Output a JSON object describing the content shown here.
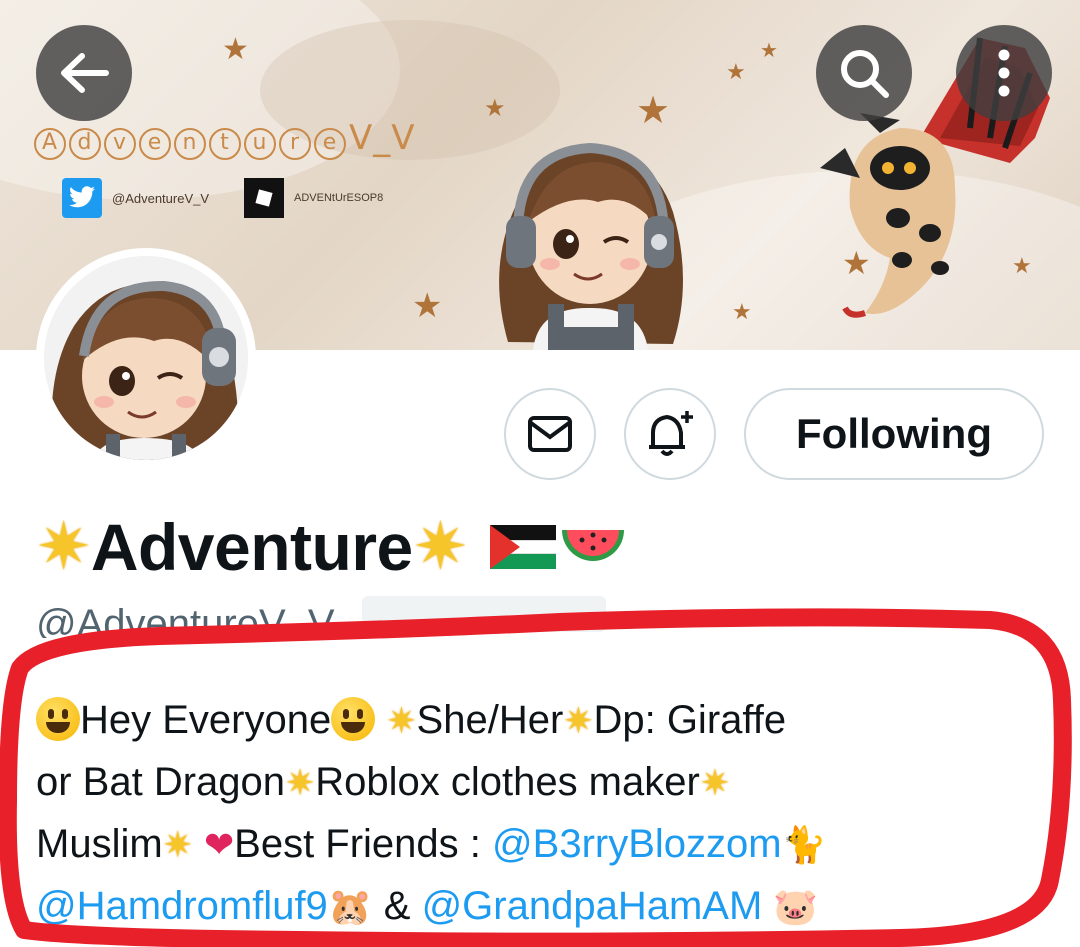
{
  "banner": {
    "handle_title": "AdventureV_V",
    "twitter_handle": "@AdventureV_V",
    "roblox_handle": "ADVENtUrESOP8"
  },
  "nav": {
    "back_icon": "arrow-left-icon",
    "search_icon": "search-icon",
    "more_icon": "more-vertical-icon"
  },
  "actions": {
    "message_icon": "envelope-icon",
    "notify_icon": "bell-plus-icon",
    "follow_label": "Following"
  },
  "profile": {
    "name": "Adventure",
    "handle": "@AdventureV_V"
  },
  "bio": {
    "line1_a": "Hey Everyone",
    "line1_b": "She/Her",
    "line1_c": "Dp: Giraffe",
    "line2_a": "or Bat Dragon",
    "line2_b": "Roblox clothes maker",
    "line3_a": "Muslim",
    "line3_b": "Best Friends :",
    "mention1": "@B3rryBlozzom",
    "mention2": "@Hamdromfluf9",
    "amp": "&",
    "mention3": "@GrandpaHamAM"
  },
  "colors": {
    "accent": "#1d9bf0",
    "annotation": "#e8202a",
    "banner_text": "#c98a4a"
  }
}
